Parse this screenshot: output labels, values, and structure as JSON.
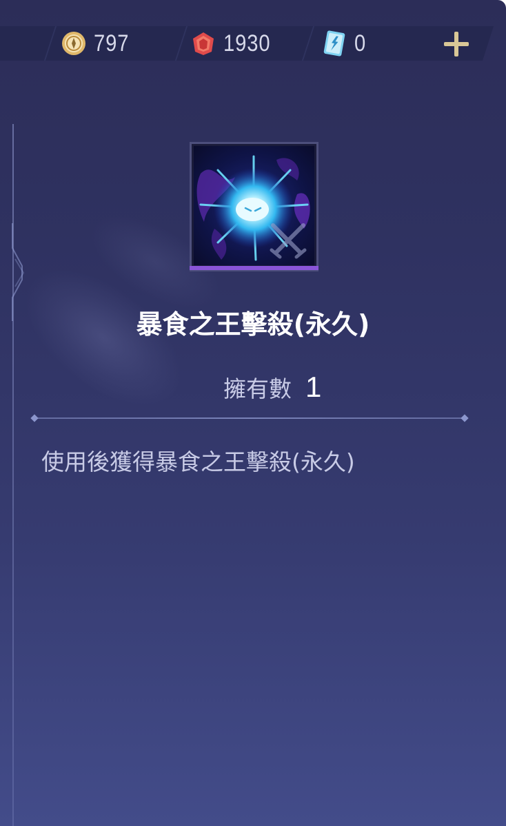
{
  "currencies": [
    {
      "name": "gold-coin",
      "amount": "797"
    },
    {
      "name": "ruby-gem",
      "amount": "1930"
    },
    {
      "name": "blue-card",
      "amount": "0"
    }
  ],
  "add_button": {
    "icon": "plus-icon",
    "color": "#d9c796"
  },
  "item": {
    "title": "暴食之王擊殺(永久)",
    "owned_label": "擁有數",
    "owned_count": "1",
    "description": "使用後獲得暴食之王擊殺(永久)",
    "rarity_color": "#8a55d8"
  }
}
